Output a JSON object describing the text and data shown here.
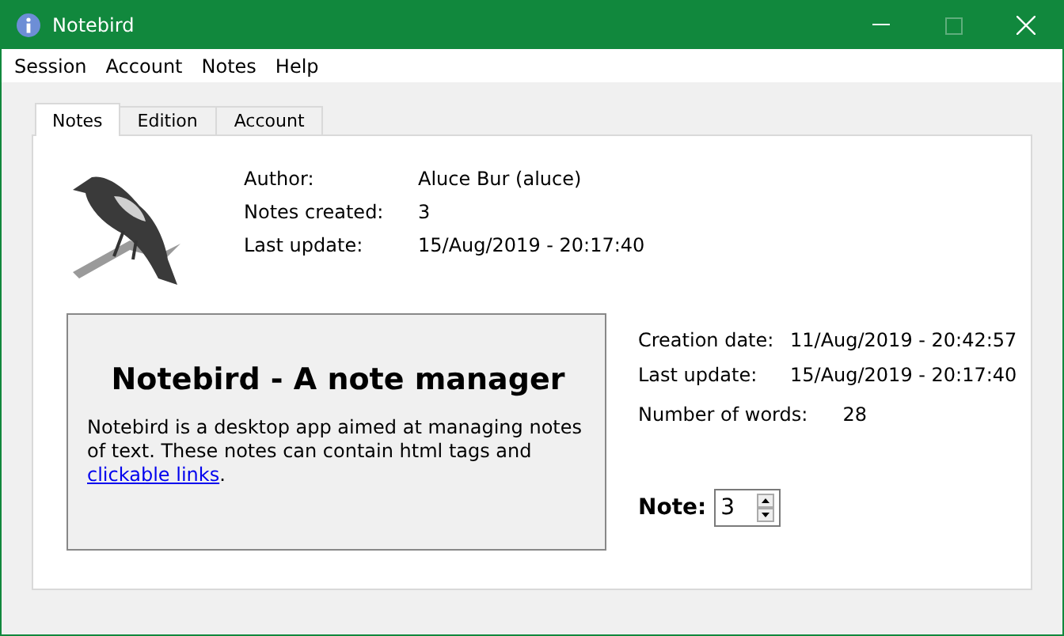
{
  "window": {
    "title": "Notebird"
  },
  "menu": [
    "Session",
    "Account",
    "Notes",
    "Help"
  ],
  "tabs": [
    {
      "label": "Notes",
      "selected": true
    },
    {
      "label": "Edition",
      "selected": false
    },
    {
      "label": "Account",
      "selected": false
    }
  ],
  "profile": [
    {
      "label": "Author:",
      "value": "Aluce Bur (aluce)"
    },
    {
      "label": "Notes created:",
      "value": "3"
    },
    {
      "label": "Last update:",
      "value": "15/Aug/2019 - 20:17:40"
    }
  ],
  "note": {
    "heading": "Notebird - A note manager",
    "body": "Notebird is a desktop app aimed at managing notes of text. These notes can contain html tags and",
    "link": "clickable links",
    "body_end": "."
  },
  "note_info": [
    {
      "label": "Creation date:",
      "value": "11/Aug/2019 - 20:42:57"
    },
    {
      "label": "Last update:",
      "value": "15/Aug/2019 - 20:17:40"
    }
  ],
  "word_count": {
    "label": "Number of words:",
    "value": "28"
  },
  "note_selector": {
    "label": "Note:",
    "value": "3"
  }
}
